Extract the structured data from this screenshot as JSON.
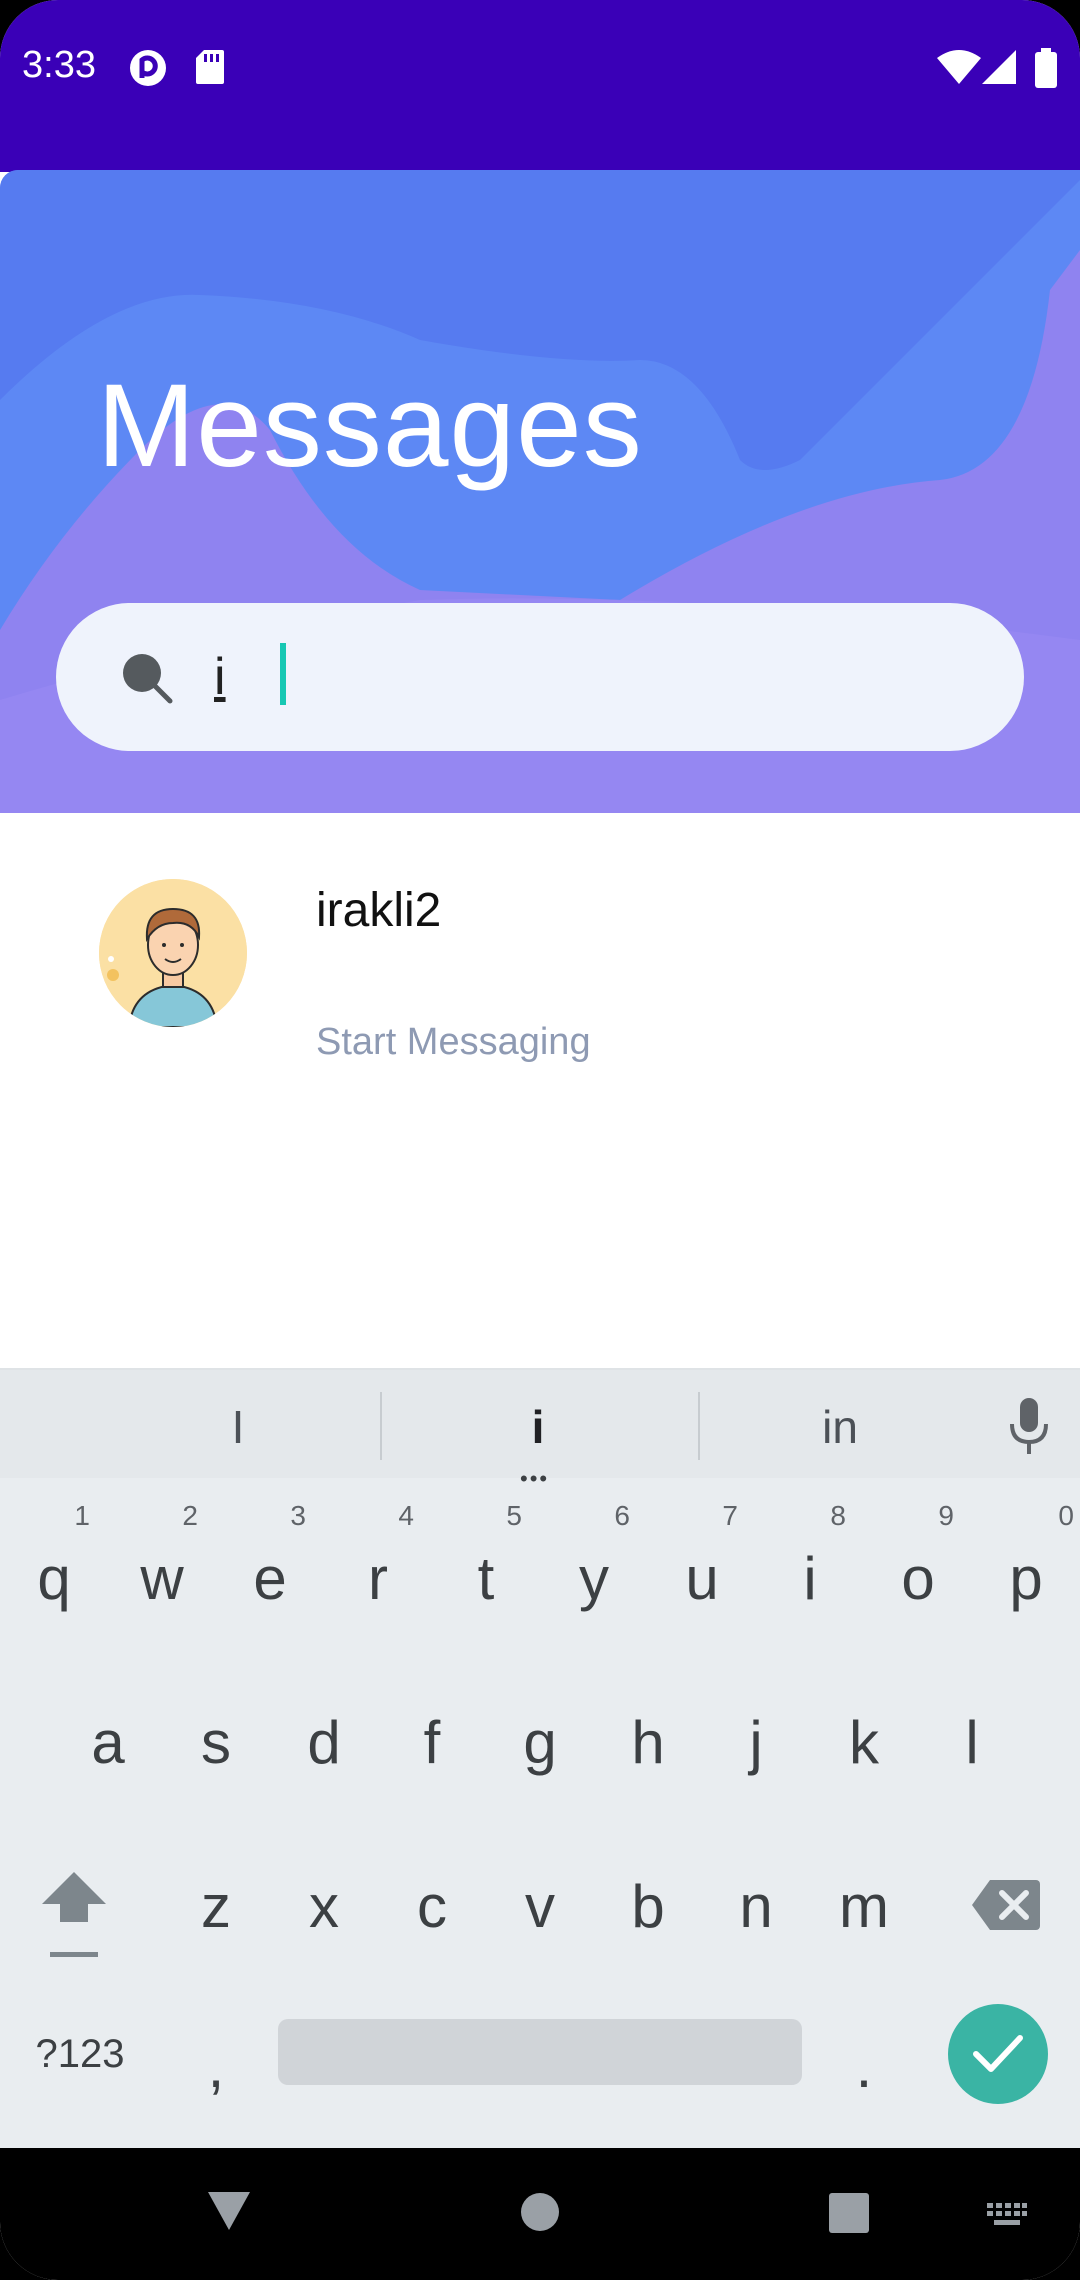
{
  "status_bar": {
    "time": "3:33",
    "left_icons": [
      "pocket-casts-icon",
      "sd-card-icon"
    ],
    "right_icons": [
      "wifi-icon",
      "signal-icon",
      "battery-icon"
    ]
  },
  "header": {
    "title": "Messages"
  },
  "search": {
    "value": "i",
    "icon": "search-icon"
  },
  "chats": [
    {
      "name": "irakli2",
      "subtitle": "Start Messaging",
      "avatar": "avatar-illustration"
    }
  ],
  "keyboard": {
    "suggestions": [
      "I",
      "i",
      "in"
    ],
    "rows": [
      [
        {
          "ch": "q",
          "hint": "1"
        },
        {
          "ch": "w",
          "hint": "2"
        },
        {
          "ch": "e",
          "hint": "3"
        },
        {
          "ch": "r",
          "hint": "4"
        },
        {
          "ch": "t",
          "hint": "5"
        },
        {
          "ch": "y",
          "hint": "6"
        },
        {
          "ch": "u",
          "hint": "7"
        },
        {
          "ch": "i",
          "hint": "8"
        },
        {
          "ch": "o",
          "hint": "9"
        },
        {
          "ch": "p",
          "hint": "0"
        }
      ],
      [
        {
          "ch": "a"
        },
        {
          "ch": "s"
        },
        {
          "ch": "d"
        },
        {
          "ch": "f"
        },
        {
          "ch": "g"
        },
        {
          "ch": "h"
        },
        {
          "ch": "j"
        },
        {
          "ch": "k"
        },
        {
          "ch": "l"
        }
      ],
      [
        {
          "ch": "z"
        },
        {
          "ch": "x"
        },
        {
          "ch": "c"
        },
        {
          "ch": "v"
        },
        {
          "ch": "b"
        },
        {
          "ch": "n"
        },
        {
          "ch": "m"
        }
      ]
    ],
    "symbols_label": "?123",
    "comma": ",",
    "period": ".",
    "icons": [
      "shift-icon",
      "backspace-icon",
      "microphone-icon",
      "enter-check-icon"
    ]
  },
  "nav_bar": {
    "icons": [
      "back-icon",
      "home-icon",
      "recents-icon",
      "keyboard-switch-icon"
    ]
  }
}
